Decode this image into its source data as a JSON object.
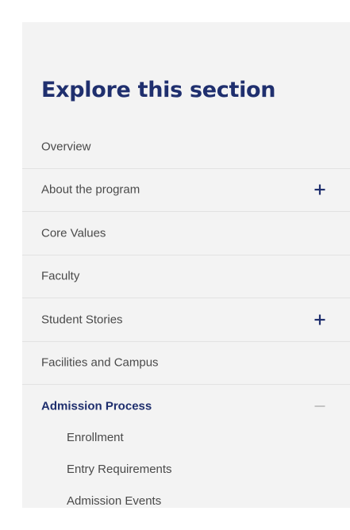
{
  "section_nav": {
    "title": "Explore this section",
    "items": [
      {
        "label": "Overview",
        "toggle": "",
        "toggle_icon": ""
      },
      {
        "label": "About the program",
        "toggle": "expand",
        "toggle_icon": "plus-icon"
      },
      {
        "label": "Core Values",
        "toggle": "",
        "toggle_icon": ""
      },
      {
        "label": "Faculty",
        "toggle": "",
        "toggle_icon": ""
      },
      {
        "label": "Student Stories",
        "toggle": "expand",
        "toggle_icon": "plus-icon"
      },
      {
        "label": "Facilities and Campus",
        "toggle": "",
        "toggle_icon": ""
      },
      {
        "label": "Admission Process",
        "toggle": "collapse",
        "toggle_icon": "minus-icon",
        "active": true
      }
    ],
    "admission_subitems": [
      "Enrollment",
      "Entry Requirements",
      "Admission Events"
    ]
  },
  "colors": {
    "panel_background": "#f3f3f3",
    "title": "#1f2f6e",
    "active_item": "#1f2f6e",
    "text": "#4a4a4a",
    "divider": "#e2e2e2",
    "plus_icon": "#1f2f6e",
    "minus_icon": "#b8b8b8"
  }
}
